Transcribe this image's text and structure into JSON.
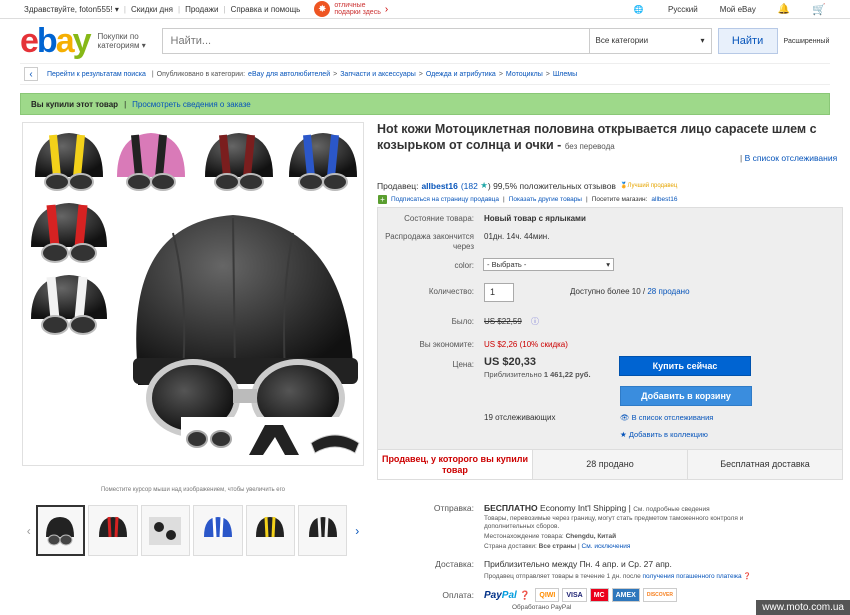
{
  "topbar": {
    "greeting": "Здравствуйте,",
    "user": "foton555!",
    "links": [
      "Скидки дня",
      "Продажи",
      "Справка и помощь"
    ],
    "promo_line1": "отличные",
    "promo_line2": "подарки здесь",
    "language": "Русский",
    "my_ebay": "Мой eBay"
  },
  "header": {
    "shop_by": "Покупки по категориям",
    "search_placeholder": "Найти...",
    "category": "Все категории",
    "find_button": "Найти",
    "advanced": "Расширенный"
  },
  "breadcrumb": {
    "back_link": "Перейти к результатам поиска",
    "published_in": "Опубликовано в категории:",
    "items": [
      "eBay для автолюбителей",
      "Запчасти и аксессуары",
      "Одежда и атрибутика",
      "Мотоциклы",
      "Шлемы"
    ]
  },
  "banner": {
    "bought": "Вы купили этот товар",
    "view_order": "Просмотреть сведения о заказе"
  },
  "gallery": {
    "hover_hint": "Поместите курсор мыши над изображением, чтобы увеличить его"
  },
  "item": {
    "title": "Hot кожи Мотоциклетная половина открывается лицо capacete шлем с козырьком от солнца и очки -",
    "title_note": "без перевода",
    "watch_link": "В список отслеживания",
    "seller_label": "Продавец:",
    "seller_name": "allbest16",
    "feedback": "(182",
    "positive": "99,5% положительных отзывов",
    "top_seller": "Лучший продавец",
    "subscribe": "Подписаться на страницу продавца",
    "other_items": "Показать другие товары",
    "visit_store": "Посетите магазин:",
    "store_name": "allbest16"
  },
  "buybox": {
    "condition_label": "Состояние товара:",
    "condition_value": "Новый товар с ярлыками",
    "ends_label": "Распродажа закончится через",
    "ends_value": "01дн. 14ч. 44мин.",
    "color_label": "color:",
    "color_value": "- Выбрать -",
    "qty_label": "Количество:",
    "qty_value": "1",
    "available": "Доступно более 10 /",
    "sold_link": "28 продано",
    "was_label": "Было:",
    "was_value": "US $22,59",
    "save_label": "Вы экономите:",
    "save_value": "US $2,26 (10% скидка)",
    "price_label": "Цена:",
    "price_value": "US $20,33",
    "approx": "Приблизительно",
    "approx_value": "1 461,22 руб.",
    "buy_now": "Купить сейчас",
    "add_cart": "Добавить в корзину",
    "watchers": "19 отслеживающих",
    "watch": "В список отслеживания",
    "add_collection": "Добавить в коллекцию",
    "bar_seller": "Продавец, у которого вы купили товар",
    "bar_sold": "28 продано",
    "bar_shipping": "Бесплатная доставка"
  },
  "shipping": {
    "ship_label": "Отправка:",
    "ship_value": "БЕСПЛАТНО",
    "ship_method": "Economy Int'l Shipping |",
    "ship_details": "См. подробные сведения",
    "ship_note": "Товары, перевозимые через границу, могут стать предметом таможенного контроля и дополнительных сборов.",
    "location_label": "Местонахождение товара:",
    "location_value": "Chengdu, Китай",
    "countries_label": "Страна доставки:",
    "countries_value": "Все страны",
    "exclusions": "См. исключения",
    "delivery_label": "Доставка:",
    "delivery_value": "Приблизительно между Пн. 4 апр. и Ср. 27 апр.",
    "delivery_note": "Продавец отправляет товары в течение 1 дн. после",
    "delivery_link": "получения погашенного платежа",
    "payment_label": "Оплата:",
    "paypal_processed": "Обработано PayPal",
    "cards": [
      "QIWI",
      "VISA",
      "MC",
      "AMEX",
      "DISCOVER"
    ]
  },
  "watermark": "www.moto.com.ua"
}
